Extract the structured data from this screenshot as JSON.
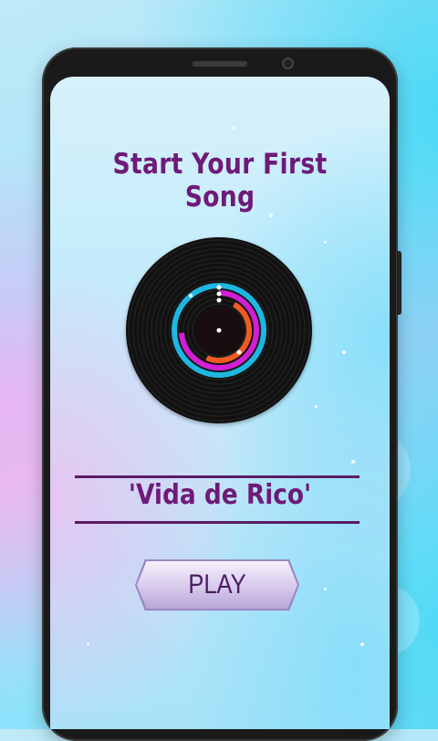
{
  "screen": {
    "title": "Start Your First Song",
    "song_name": "'Vida de Rico'",
    "play_label": "PLAY"
  },
  "icons": {
    "record": "vinyl-record-icon"
  },
  "colors": {
    "title": "#6f1a78",
    "ring_cyan": "#1fb6e0",
    "ring_magenta": "#d21ed4",
    "ring_orange": "#f15a24"
  }
}
